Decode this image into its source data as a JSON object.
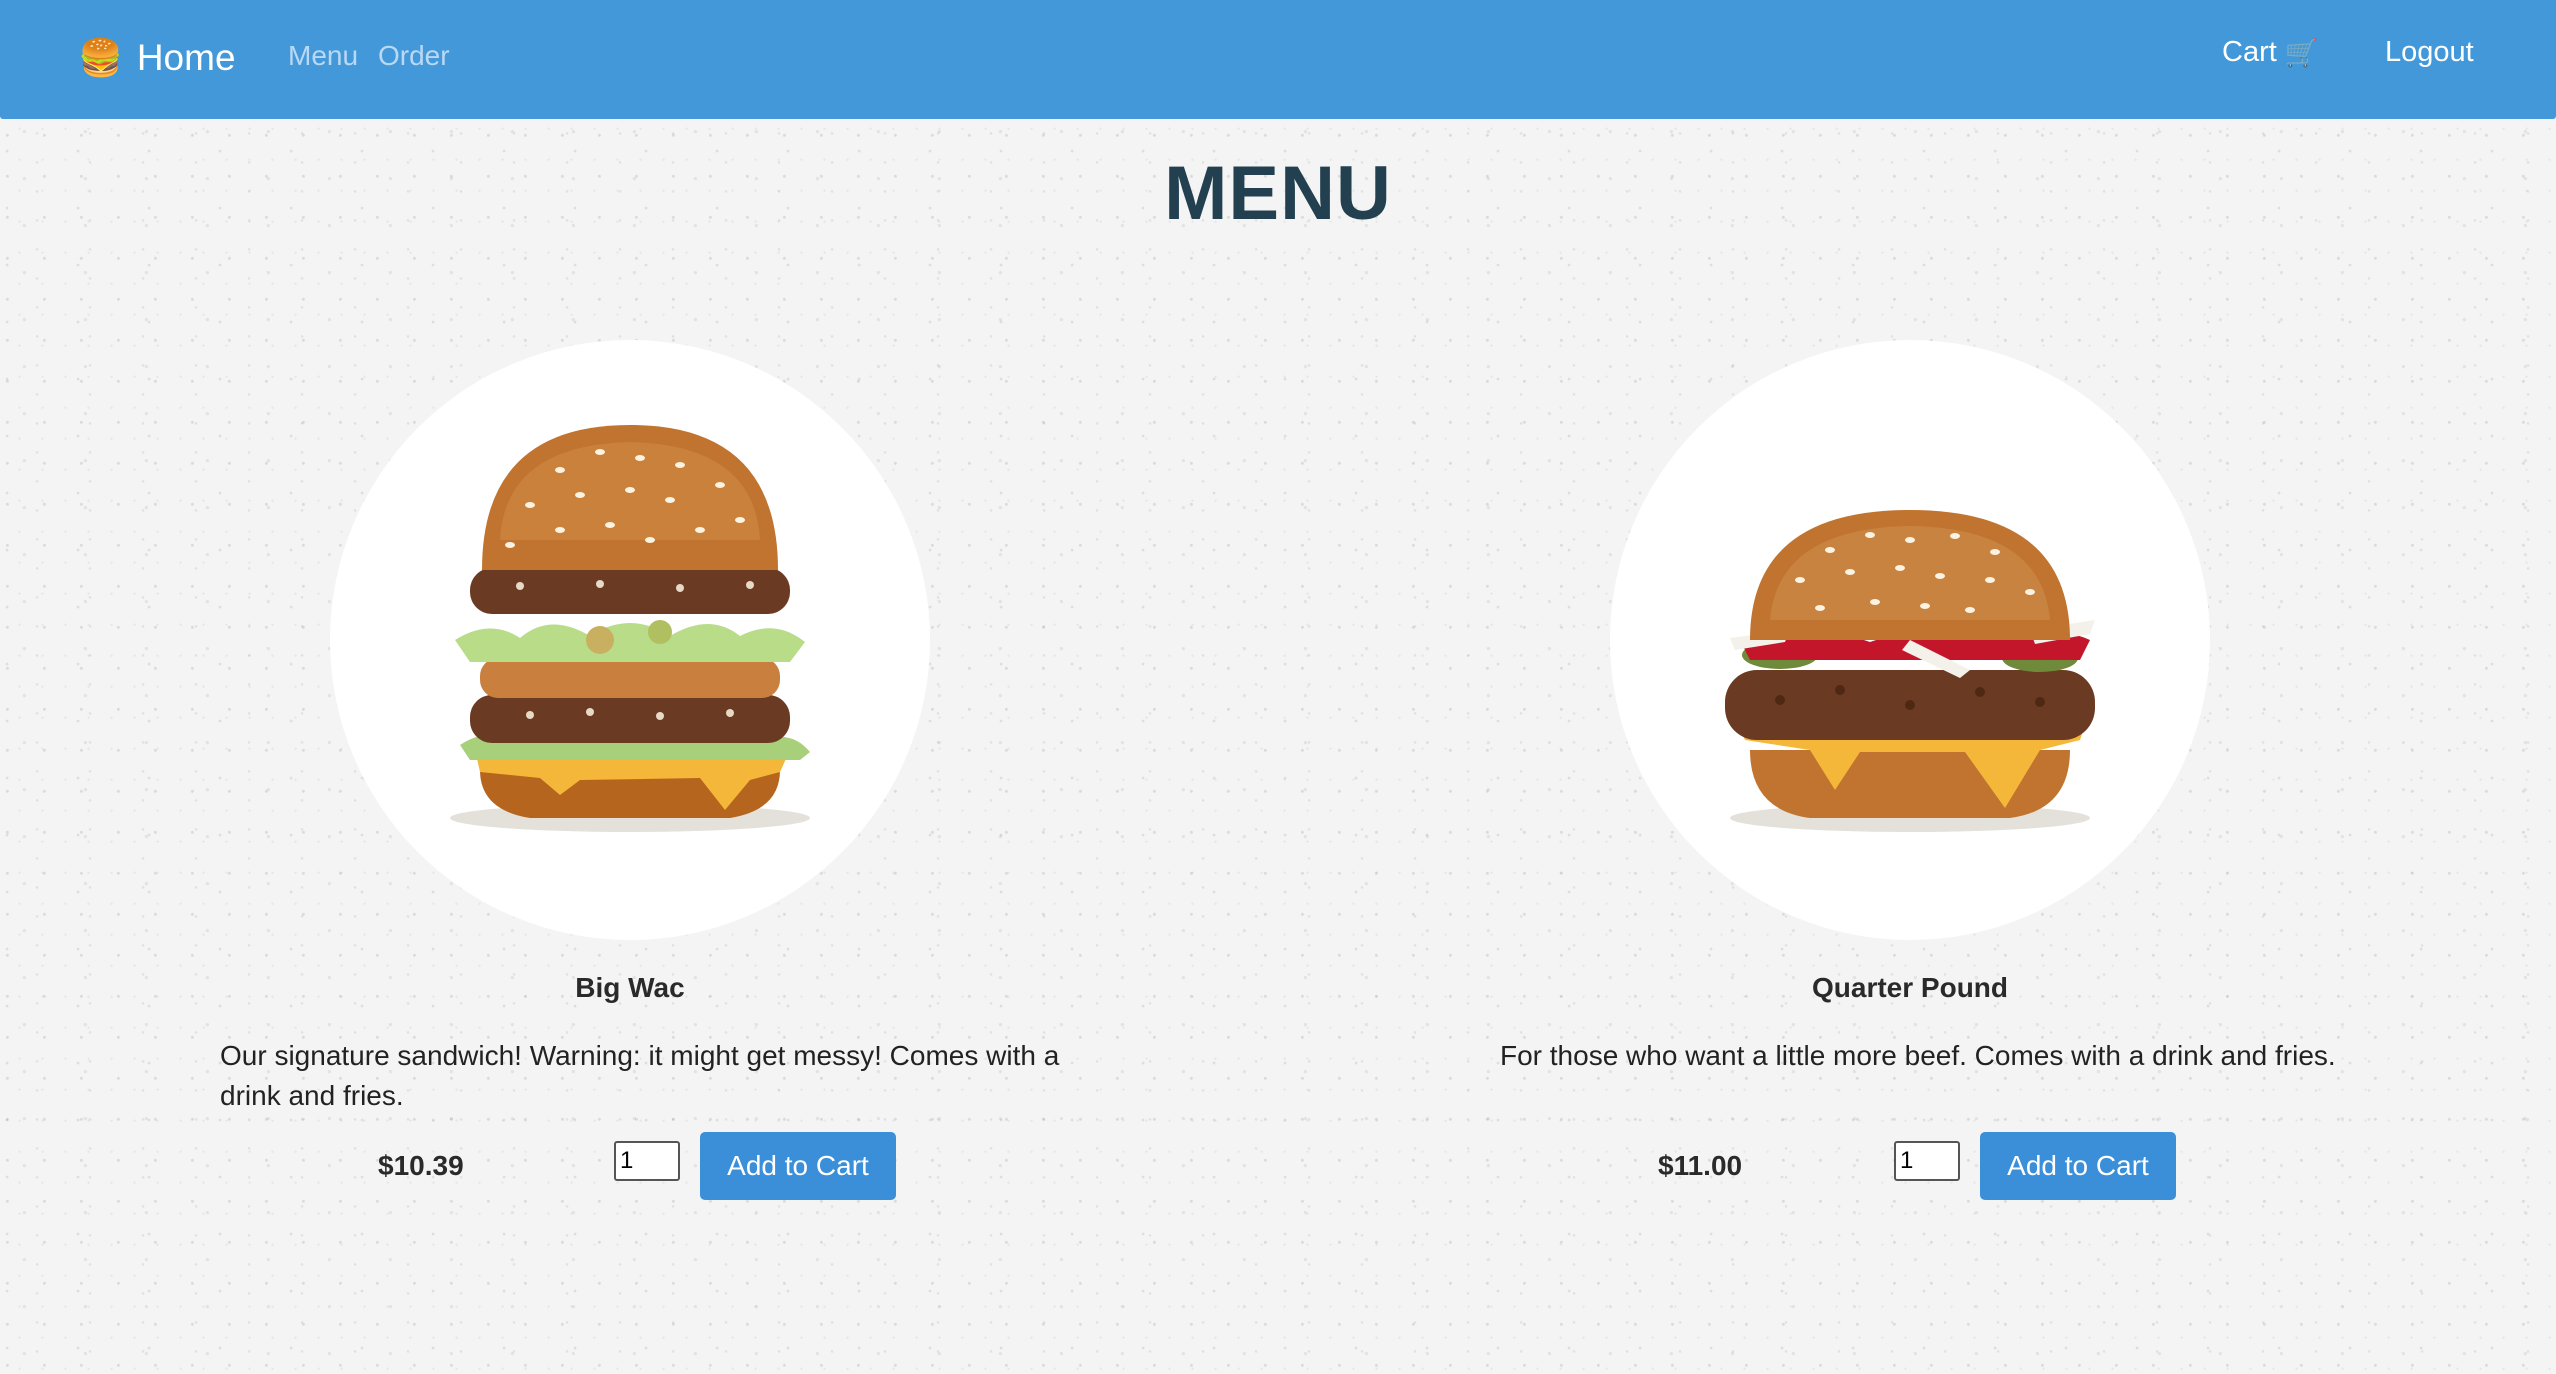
{
  "nav": {
    "brand_icon": "🍔",
    "brand_label": "Home",
    "links": [
      {
        "label": "Menu"
      },
      {
        "label": "Order"
      }
    ],
    "cart_label": "Cart",
    "cart_icon": "🛒",
    "logout_label": "Logout"
  },
  "page": {
    "title": "MENU"
  },
  "products": [
    {
      "name": "Big Wac",
      "image_icon": "burger-image",
      "description": "Our signature sandwich! Warning: it might get messy! Comes with a drink and fries.",
      "price": "$10.39",
      "quantity": "1",
      "add_label": "Add to Cart"
    },
    {
      "name": "Quarter Pound",
      "image_icon": "burger-image",
      "description": "For those who want a little more beef. Comes with a drink and fries.",
      "price": "$11.00",
      "quantity": "1",
      "add_label": "Add to Cart"
    }
  ],
  "colors": {
    "navbar": "#4398da",
    "button": "#3b8fd8",
    "title": "#22404f"
  }
}
